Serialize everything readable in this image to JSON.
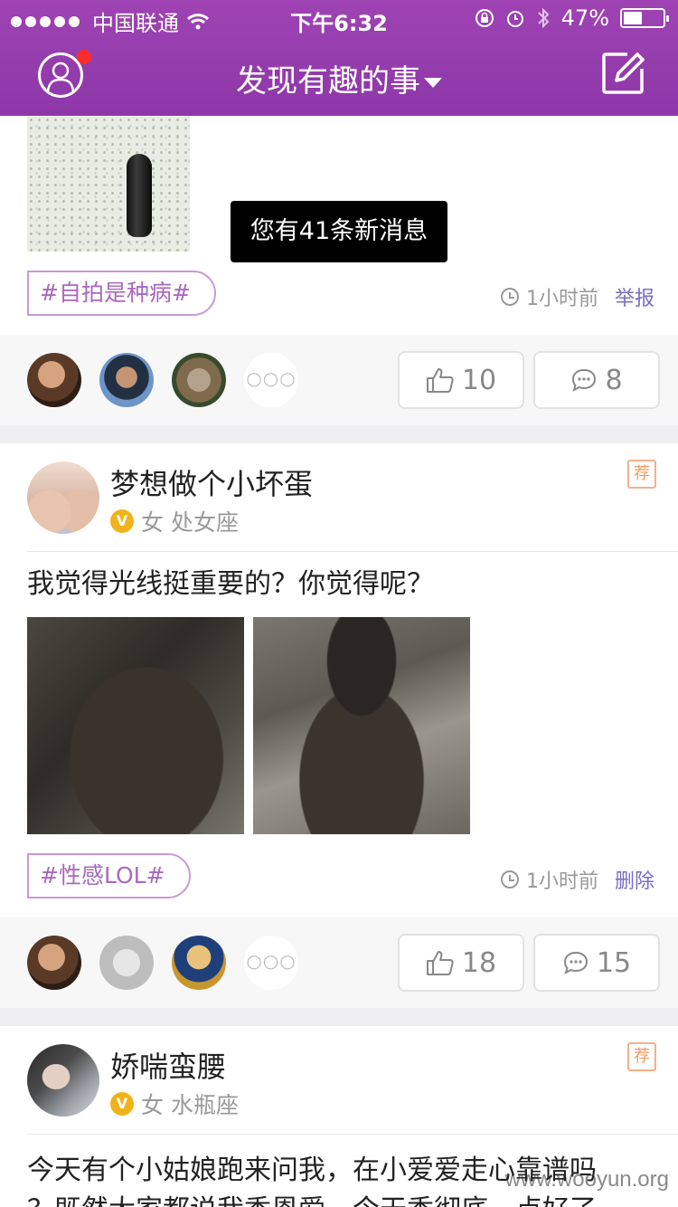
{
  "status_bar": {
    "carrier": "中国联通",
    "time": "下午6:32",
    "battery": "47%",
    "battery_level": 0.47
  },
  "nav": {
    "title": "发现有趣的事"
  },
  "toast": "您有41条新消息",
  "posts": [
    {
      "tag": "#自拍是种病#",
      "time": "1小时前",
      "action": "举报",
      "likes": "10",
      "comments": "8"
    },
    {
      "author": "梦想做个小坏蛋",
      "badge": "V",
      "gender": "女",
      "zodiac": "处女座",
      "recommend": "荐",
      "text": "我觉得光线挺重要的？你觉得呢？",
      "tag": "#性感LOL#",
      "time": "1小时前",
      "action": "删除",
      "likes": "18",
      "comments": "15"
    },
    {
      "author": "娇喘蛮腰",
      "badge": "V",
      "gender": "女",
      "zodiac": "水瓶座",
      "recommend": "荐",
      "text_line1": "今天有个小姑娘跑来问我，在小爱爱走心靠谱吗",
      "text_line2": "？既然大家都说我香恩爱，今天香彻底一点好了"
    }
  ],
  "more_label": "○○○",
  "watermark": "www.wooyun.org"
}
